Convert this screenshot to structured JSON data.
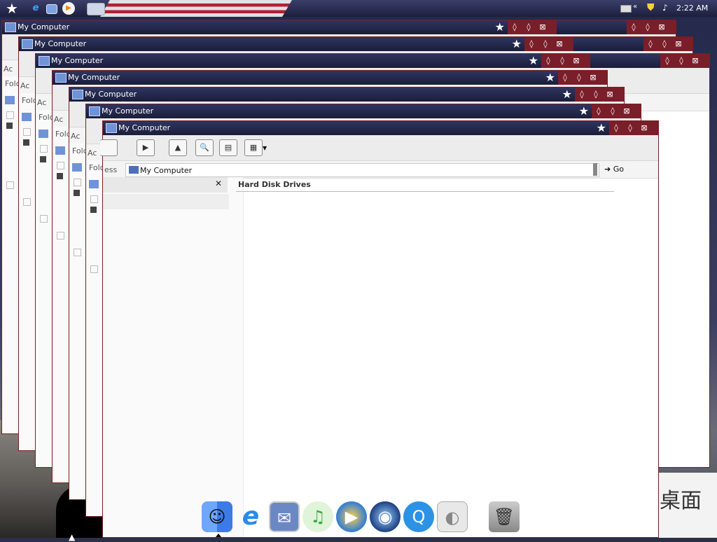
{
  "taskbar": {
    "clock": "2:22 AM",
    "tray_arrow": "«"
  },
  "window": {
    "title": "My Computer"
  },
  "back_windows": {
    "address_partial": "Ac",
    "folders_partial": "Folc"
  },
  "front_window": {
    "address_label": "ess",
    "address_value": "My Computer",
    "go_label": "Go",
    "section_header": "Hard Disk Drives"
  },
  "title_buttons": [
    "◊",
    "◊",
    "⊠"
  ],
  "desktop": {
    "logo_text": "桌面"
  },
  "dock": {
    "items": [
      "finder-icon",
      "internet-explorer-icon",
      "mail-icon",
      "itunes-icon",
      "media-player-icon",
      "dvd-player-icon",
      "quicktime-icon",
      "apple-icon",
      "trash-icon"
    ]
  }
}
